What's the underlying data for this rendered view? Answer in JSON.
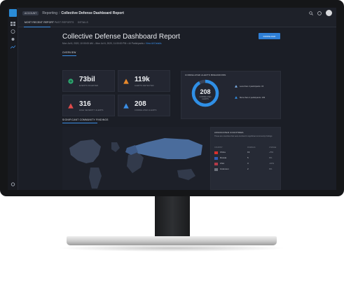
{
  "topbar": {
    "account": "ACCOUNT",
    "breadcrumb_parent": "Reporting",
    "breadcrumb_separator": "/",
    "breadcrumb_current": "Collective Defense Dashboard Report"
  },
  "tabs": [
    {
      "label": "MOST RECENT REPORT",
      "active": true
    },
    {
      "label": "PAST REPORTS",
      "active": false
    },
    {
      "label": "DETAILS",
      "active": false
    }
  ],
  "report": {
    "title": "Collective Defense Dashboard Report",
    "subtitle": "Mon Jul 6, 2020, 10:00:00 AM – Mon Jul 6, 2020, 11:00:00 PM • 44 Participants •",
    "subtitle_link": "View All Details",
    "download_label": "DOWNLOAD"
  },
  "overview": {
    "section_label": "OVERVIEW",
    "stats": [
      {
        "value": "73bil",
        "label": "EVENTS INGESTED",
        "icon": "globe-icon",
        "color": "#2fa872"
      },
      {
        "value": "119k",
        "label": "ALERTS DETECTED",
        "icon": "warning-icon",
        "color": "#e8892b"
      },
      {
        "value": "316",
        "label": "HIGH SEVERITY ALERTS",
        "icon": "warning-icon",
        "color": "#e04b4b"
      },
      {
        "value": "208",
        "label": "CORRELATED ALERTS",
        "icon": "warning-icon",
        "color": "#3a8ee6"
      }
    ]
  },
  "correlated": {
    "title": "CORRELATED ALERTS BREAKDOWN",
    "value": "208",
    "label_line1": "CORRELATED",
    "label_line2": "ALERTS",
    "ring_fraction": 0.92,
    "ring_color": "#2f8fe6",
    "legend": [
      {
        "label": "Less than 2 participants: 15",
        "color": "#7fb2ec"
      },
      {
        "label": "More than 2 participants: 193",
        "color": "#2f8fe6"
      }
    ]
  },
  "findings": {
    "section_label": "SIGNIFICANT COMMUNITY FINDINGS"
  },
  "countries": {
    "title": "ASSOCIATED COUNTRIES",
    "description": "These are countries that were involved in significant community findings",
    "headers": [
      "COUNTRY",
      "FINDINGS",
      "CHANGE"
    ],
    "rows": [
      {
        "name": "China",
        "findings": "19",
        "change": "+5%",
        "flag_color": "#d8312c"
      },
      {
        "name": "Russia",
        "findings": "5",
        "change": "0%",
        "flag_color": "#2f5db8"
      },
      {
        "name": "USA",
        "findings": "3",
        "change": "-10%",
        "flag_color": "#b23a48"
      },
      {
        "name": "Unknown",
        "findings": "2",
        "change": "0%",
        "flag_color": "#6d727c"
      }
    ]
  }
}
